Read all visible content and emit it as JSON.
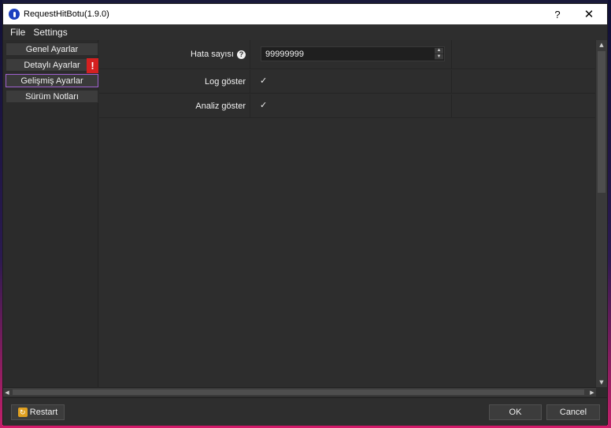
{
  "window": {
    "title": "RequestHitBotu(1.9.0)",
    "help_label": "?",
    "close_label": "✕"
  },
  "menu": [
    "File",
    "Settings"
  ],
  "sidebar": {
    "items": [
      {
        "label": "Genel Ayarlar"
      },
      {
        "label": "Detaylı Ayarlar",
        "warning": "!"
      },
      {
        "label": "Gelişmiş Ayarlar",
        "active": true
      },
      {
        "label": "Sürüm Notları"
      }
    ]
  },
  "settings": {
    "error_count": {
      "label": "Hata sayısı",
      "help": "?",
      "value": "99999999"
    },
    "show_log": {
      "label": "Log göster",
      "checked": true,
      "mark": "✓"
    },
    "show_analysis": {
      "label": "Analiz göster",
      "checked": true,
      "mark": "✓"
    }
  },
  "footer": {
    "restart_label": "Restart",
    "ok_label": "OK",
    "cancel_label": "Cancel"
  },
  "colors": {
    "accent_border": "#a060d0",
    "warning": "#d42020",
    "app_icon": "#1b3fbf"
  }
}
